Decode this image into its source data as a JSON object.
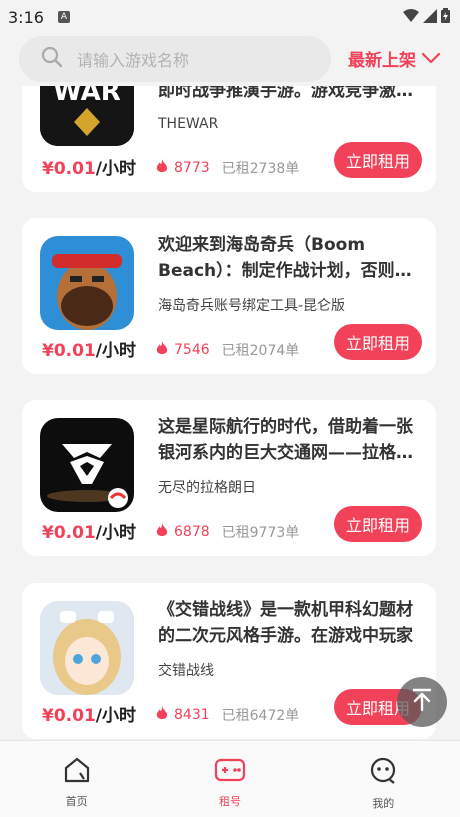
{
  "status_bar": {
    "time": "3:16",
    "notif": "A"
  },
  "search": {
    "placeholder": "请输入游戏名称",
    "sort_label": "最新上架"
  },
  "games": [
    {
      "title": "即时战争推演手游。游戏竞争激烈，策略至上",
      "subtitle": "THEWAR",
      "price": "¥0.01",
      "unit": "/小时",
      "hot": "8773",
      "rented": "已租2738单",
      "button": "立即租用",
      "icon": "war-game-icon"
    },
    {
      "title": "欢迎来到海岛奇兵（Boom Beach）：制定作战计划，否则就会失败",
      "subtitle": "海岛奇兵账号绑定工具-昆仑版",
      "price": "¥0.01",
      "unit": "/小时",
      "hot": "7546",
      "rented": "已租2074单",
      "button": "立即租用",
      "icon": "boom-beach-icon"
    },
    {
      "title": "这是星际航行的时代，借助着一张银河系内的巨大交通网——拉格朗日",
      "subtitle": "无尽的拉格朗日",
      "price": "¥0.01",
      "unit": "/小时",
      "hot": "6878",
      "rented": "已租9773单",
      "button": "立即租用",
      "icon": "lagrange-icon"
    },
    {
      "title": "《交错战线》是一款机甲科幻题材的二次元风格手游。在游戏中玩家",
      "subtitle": "交错战线",
      "price": "¥0.01",
      "unit": "/小时",
      "hot": "8431",
      "rented": "已租6472单",
      "button": "立即租用",
      "icon": "crosscore-icon"
    }
  ],
  "nav": [
    {
      "label": "首页",
      "icon": "home-icon"
    },
    {
      "label": "租号",
      "icon": "gamepad-icon"
    },
    {
      "label": "我的",
      "icon": "profile-icon"
    }
  ],
  "colors": {
    "accent": "#f2425a"
  }
}
